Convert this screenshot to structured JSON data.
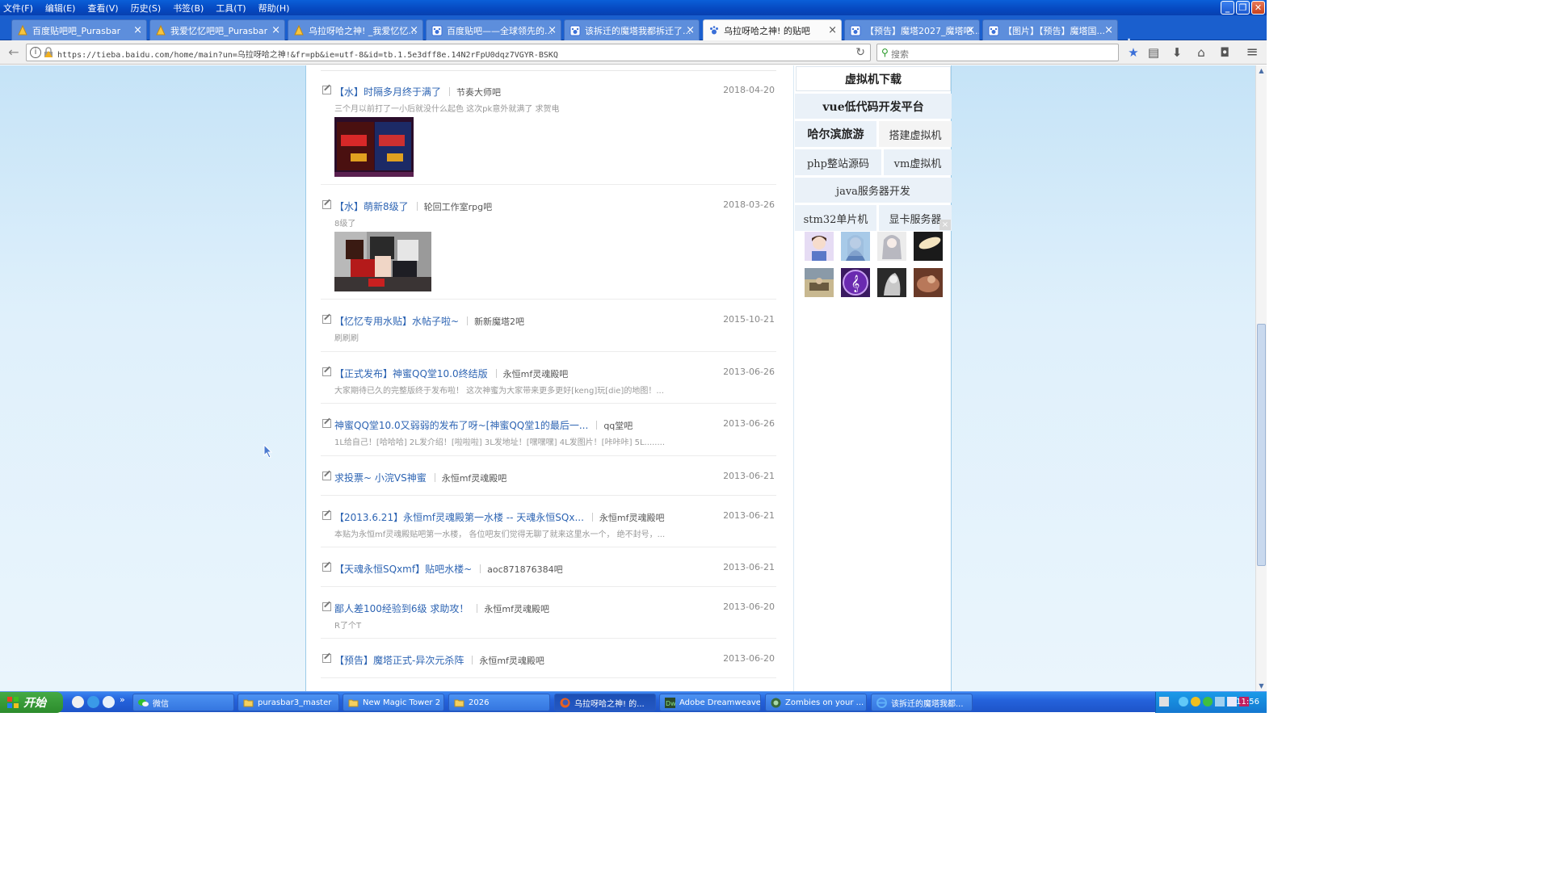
{
  "menu": [
    "文件(F)",
    "编辑(E)",
    "查看(V)",
    "历史(S)",
    "书签(B)",
    "工具(T)",
    "帮助(H)"
  ],
  "tabs": [
    {
      "label": "百度贴吧吧_Purasbar",
      "icon": "purasbar-icon"
    },
    {
      "label": "我爱忆忆吧吧_Purasbar",
      "icon": "purasbar-icon"
    },
    {
      "label": "乌拉呀哈之神! _我爱忆忆...",
      "icon": "purasbar-icon"
    },
    {
      "label": "百度贴吧——全球领先的...",
      "icon": "tieba-paw-icon"
    },
    {
      "label": "该拆迁的魔塔我都拆迁了...",
      "icon": "tieba-paw-icon"
    },
    {
      "label": "乌拉呀哈之神! 的贴吧",
      "icon": "tieba-paw-icon",
      "active": true
    },
    {
      "label": "【预告】魔塔2027_魔塔吧...",
      "icon": "tieba-paw-icon"
    },
    {
      "label": "【图片】【预告】魔塔国...",
      "icon": "tieba-paw-icon"
    }
  ],
  "navbar": {
    "url": "https://tieba.baidu.com/home/main?un=乌拉呀哈之神!&fr=pb&ie=utf-8&id=tb.1.5e3dff8e.14N2rFpU0dqz7VGYR-BSKQ",
    "search_placeholder": "搜索"
  },
  "posts": [
    {
      "title": "【水】时隔多月终于满了",
      "forum": "节奏大师吧",
      "date": "2018-04-20",
      "excerpt": "三个月以前打了一小后就没什么起色 这次pk意外就满了 求贺电",
      "has_image": "game-screenshot"
    },
    {
      "title": "【水】萌新8级了",
      "forum": "轮回工作室rpg吧",
      "date": "2018-03-26",
      "excerpt": "8级了",
      "has_image": "pixel-art"
    },
    {
      "title": "【忆忆专用水贴】水帖子啦~",
      "forum": "新新魔塔2吧",
      "date": "2015-10-21",
      "excerpt": "刷刷刷"
    },
    {
      "title": "【正式发布】神蜜QQ堂10.0终结版",
      "forum": "永恒mf灵魂殿吧",
      "date": "2013-06-26",
      "excerpt": "大家期待已久的完整版终于发布啦！ 这次神蜜为大家带来更多更好[keng]玩[die]的地图！..."
    },
    {
      "title": "神蜜QQ堂10.0又弱弱的发布了呀~[神蜜QQ堂1的最后一...",
      "forum": "qq堂吧",
      "date": "2013-06-26",
      "excerpt": "1L给自己！[哈哈哈] 2L发介绍！[啦啦啦] 3L发地址！[嘿嘿嘿] 4L发图片！[咔咔咔] 5L........"
    },
    {
      "title": "求投票~ 小浣VS神蜜",
      "forum": "永恒mf灵魂殿吧",
      "date": "2013-06-21",
      "excerpt": ""
    },
    {
      "title": "【2013.6.21】永恒mf灵魂殿第一水楼 -- 天魂永恒SQx...",
      "forum": "永恒mf灵魂殿吧",
      "date": "2013-06-21",
      "excerpt": "本贴为永恒mf灵魂殿贴吧第一水楼， 各位吧友们觉得无聊了就来这里水一个， 绝不封号，..."
    },
    {
      "title": "【天魂永恒SQxmf】贴吧水楼~",
      "forum": "aoc871876384吧",
      "date": "2013-06-21",
      "excerpt": ""
    },
    {
      "title": "鄙人差100经验到6级 求助攻！",
      "forum": "永恒mf灵魂殿吧",
      "date": "2013-06-20",
      "excerpt": "R了个T"
    },
    {
      "title": "【预告】魔塔正式-异次元杀阵",
      "forum": "永恒mf灵魂殿吧",
      "date": "2013-06-20",
      "excerpt": ""
    }
  ],
  "sidebar": {
    "top": "虚拟机下载",
    "row1": "vue低代码开发平台",
    "row2": [
      "哈尔滨旅游",
      "搭建虚拟机"
    ],
    "row3": [
      "php整站源码",
      "vm虚拟机"
    ],
    "row4": "java服务器开发",
    "row5": [
      "stm32单片机",
      "显卡服务器"
    ]
  },
  "taskbar": {
    "start": "开始",
    "buttons": [
      {
        "label": "微信",
        "icon": "wechat-icon"
      },
      {
        "label": "purasbar3_master",
        "icon": "folder-icon"
      },
      {
        "label": "New Magic Tower 2",
        "icon": "folder-icon"
      },
      {
        "label": "2026",
        "icon": "folder-icon"
      },
      {
        "label": "乌拉呀哈之神! 的...",
        "icon": "firefox-icon",
        "active": true
      },
      {
        "label": "Adobe Dreamweave...",
        "icon": "dreamweaver-icon"
      },
      {
        "label": "Zombies on your ...",
        "icon": "game-icon"
      },
      {
        "label": "该拆迁的魔塔我都...",
        "icon": "ie-icon"
      }
    ],
    "clock": "11:56"
  },
  "colors": {
    "link": "#2d64b3",
    "page_bg": "#c5e3f7",
    "taskbar": "#2563dc"
  }
}
